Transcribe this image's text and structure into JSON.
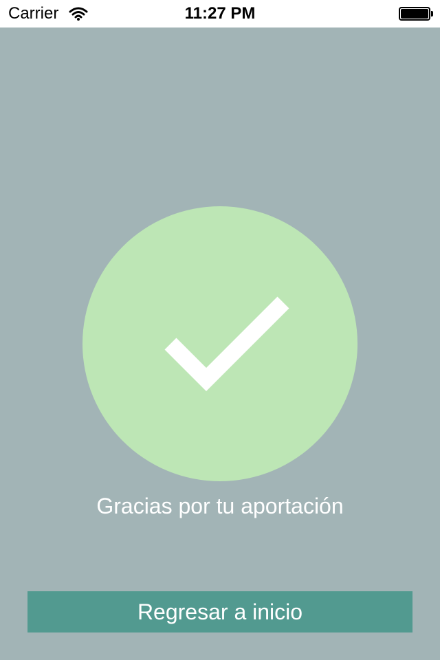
{
  "status_bar": {
    "carrier": "Carrier",
    "time": "11:27 PM",
    "icons": {
      "wifi": "wifi-icon",
      "battery": "battery-icon"
    },
    "battery_level_fraction": 1.0
  },
  "confirmation": {
    "icon": "checkmark-icon",
    "message": "Gracias por tu aportación"
  },
  "actions": {
    "home_button_label": "Regresar a inicio"
  },
  "colors": {
    "background": "#a2b4b6",
    "circle": "#bde6b5",
    "check": "#ffffff",
    "button": "#529a90",
    "text": "#ffffff"
  }
}
